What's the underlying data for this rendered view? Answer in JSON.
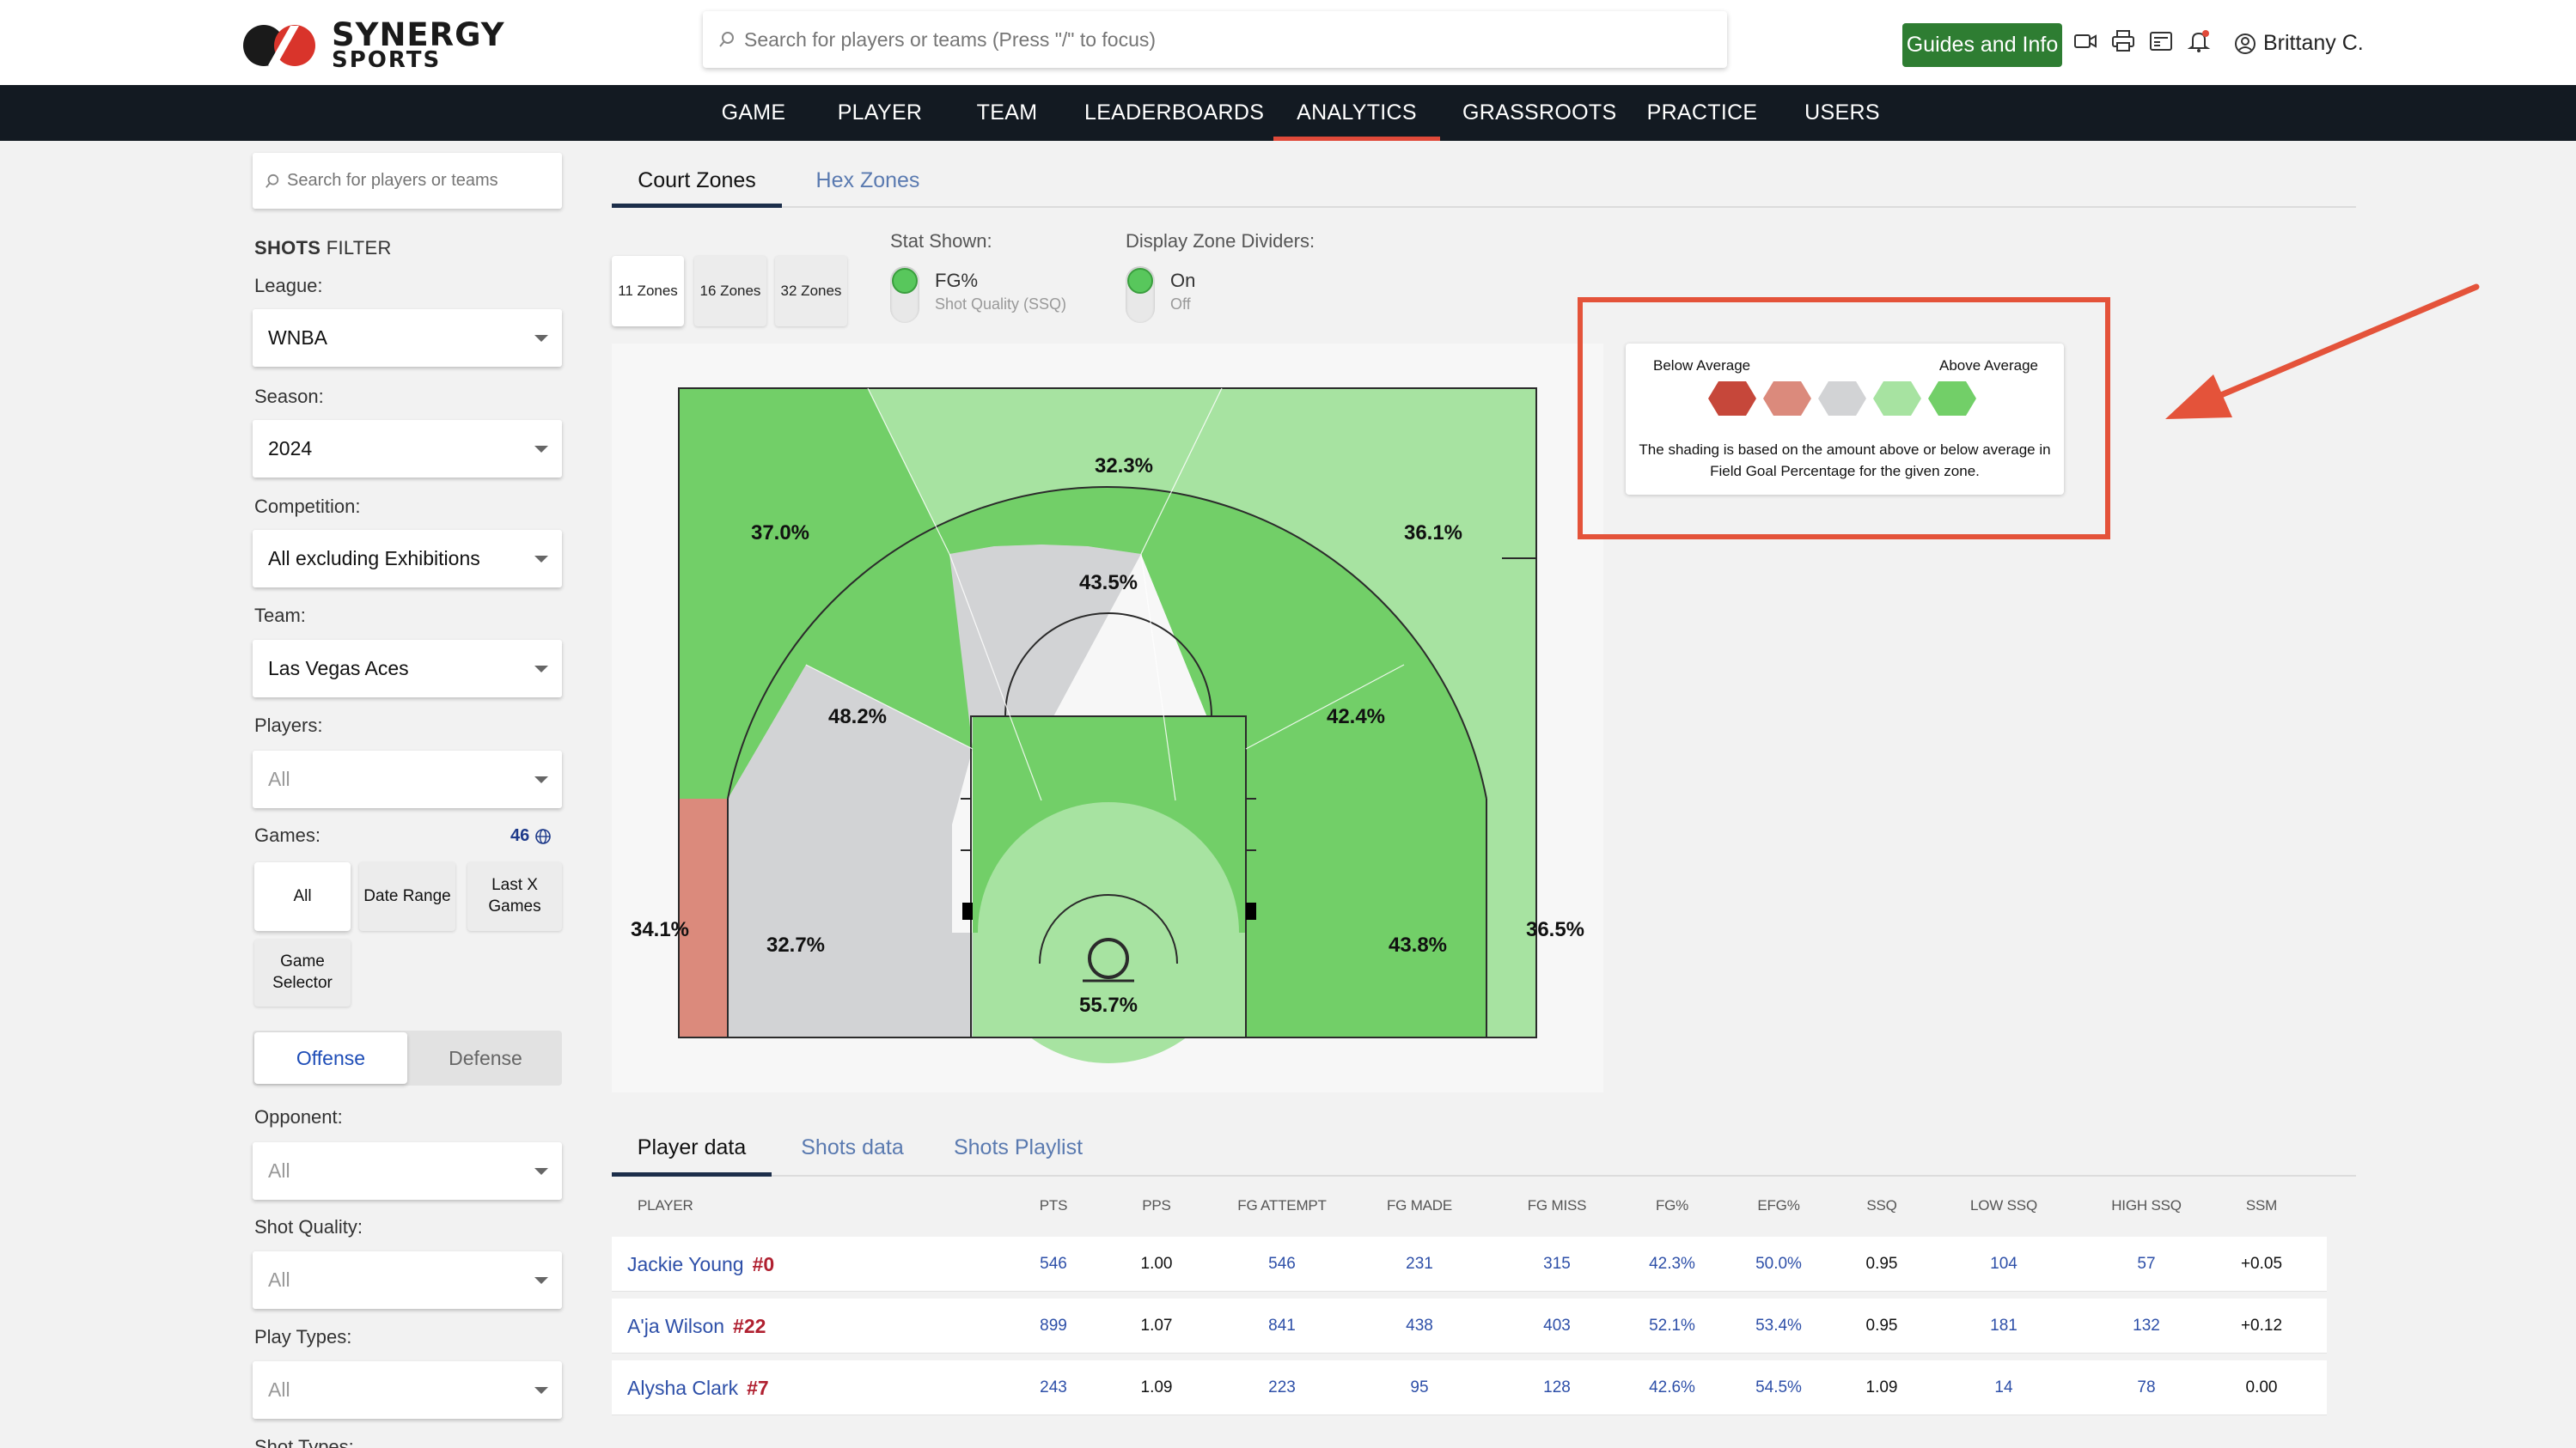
{
  "brand": {
    "line1": "SYNERGY",
    "line2": "SPORTS"
  },
  "header": {
    "search_placeholder": "Search for players or teams (Press \"/\" to focus)",
    "guides_label": "Guides and Info",
    "user_name": "Brittany C."
  },
  "nav": {
    "items": [
      "GAME",
      "PLAYER",
      "TEAM",
      "LEADERBOARDS",
      "ANALYTICS",
      "GRASSROOTS",
      "PRACTICE",
      "USERS"
    ],
    "active": "ANALYTICS"
  },
  "sidebar": {
    "search_placeholder": "Search for players or teams",
    "filter_title_bold": "SHOTS",
    "filter_title_rest": " FILTER",
    "league_label": "League:",
    "league_value": "WNBA",
    "season_label": "Season:",
    "season_value": "2024",
    "competition_label": "Competition:",
    "competition_value": "All excluding Exhibitions",
    "team_label": "Team:",
    "team_value": "Las Vegas Aces",
    "players_label": "Players:",
    "players_value": "All",
    "games_label": "Games:",
    "games_count": "46",
    "games_buttons": {
      "all": "All",
      "date_range": "Date Range",
      "last_x_1": "Last X",
      "last_x_2": "Games",
      "selector_1": "Game",
      "selector_2": "Selector"
    },
    "offense_label": "Offense",
    "defense_label": "Defense",
    "opponent_label": "Opponent:",
    "opponent_value": "All",
    "shot_quality_label": "Shot Quality:",
    "shot_quality_value": "All",
    "play_types_label": "Play Types:",
    "play_types_value": "All",
    "shot_types_label": "Shot Types:"
  },
  "zone_tabs": {
    "court": "Court Zones",
    "hex": "Hex Zones"
  },
  "zone_buttons": [
    "11 Zones",
    "16 Zones",
    "32 Zones"
  ],
  "stat_shown": {
    "label": "Stat Shown:",
    "on": "FG%",
    "off": "Shot Quality (SSQ)"
  },
  "dividers": {
    "label": "Display Zone Dividers:",
    "on": "On",
    "off": "Off"
  },
  "court_zones": {
    "left_corner": "34.1%",
    "left_baseline_mid": "32.7%",
    "paint": "55.7%",
    "right_baseline_mid": "43.8%",
    "right_corner": "36.5%",
    "left_wing_mid": "48.2%",
    "top_mid": "43.5%",
    "right_wing_mid": "42.4%",
    "left_wing_three": "37.0%",
    "top_three": "32.3%",
    "right_wing_three": "36.1%"
  },
  "zone_colors": {
    "below_strong": "#c6473a",
    "below": "#db8a7c",
    "average": "#d2d3d5",
    "above": "#a7e3a1",
    "above_strong": "#72cf68"
  },
  "legend": {
    "below_label": "Below Average",
    "above_label": "Above Average",
    "desc1": "The shading is based on the amount above or below average in",
    "desc2": "Field Goal Percentage for the given zone."
  },
  "data_tabs": {
    "player": "Player data",
    "shots": "Shots data",
    "playlist": "Shots Playlist"
  },
  "table": {
    "columns": [
      "PLAYER",
      "PTS",
      "PPS",
      "FG ATTEMPT",
      "FG MADE",
      "FG MISS",
      "FG%",
      "EFG%",
      "SSQ",
      "LOW SSQ",
      "HIGH SSQ",
      "SSM"
    ],
    "rows": [
      {
        "name": "Jackie Young",
        "num": "#0",
        "pts": "546",
        "pps": "1.00",
        "fga": "546",
        "fgm": "231",
        "miss": "315",
        "fgp": "42.3%",
        "efg": "50.0%",
        "ssq": "0.95",
        "low": "104",
        "high": "57",
        "ssm": "+0.05"
      },
      {
        "name": "A'ja Wilson",
        "num": "#22",
        "pts": "899",
        "pps": "1.07",
        "fga": "841",
        "fgm": "438",
        "miss": "403",
        "fgp": "52.1%",
        "efg": "53.4%",
        "ssq": "0.95",
        "low": "181",
        "high": "132",
        "ssm": "+0.12"
      },
      {
        "name": "Alysha Clark",
        "num": "#7",
        "pts": "243",
        "pps": "1.09",
        "fga": "223",
        "fgm": "95",
        "miss": "128",
        "fgp": "42.6%",
        "efg": "54.5%",
        "ssq": "1.09",
        "low": "14",
        "high": "78",
        "ssm": "0.00"
      }
    ]
  }
}
